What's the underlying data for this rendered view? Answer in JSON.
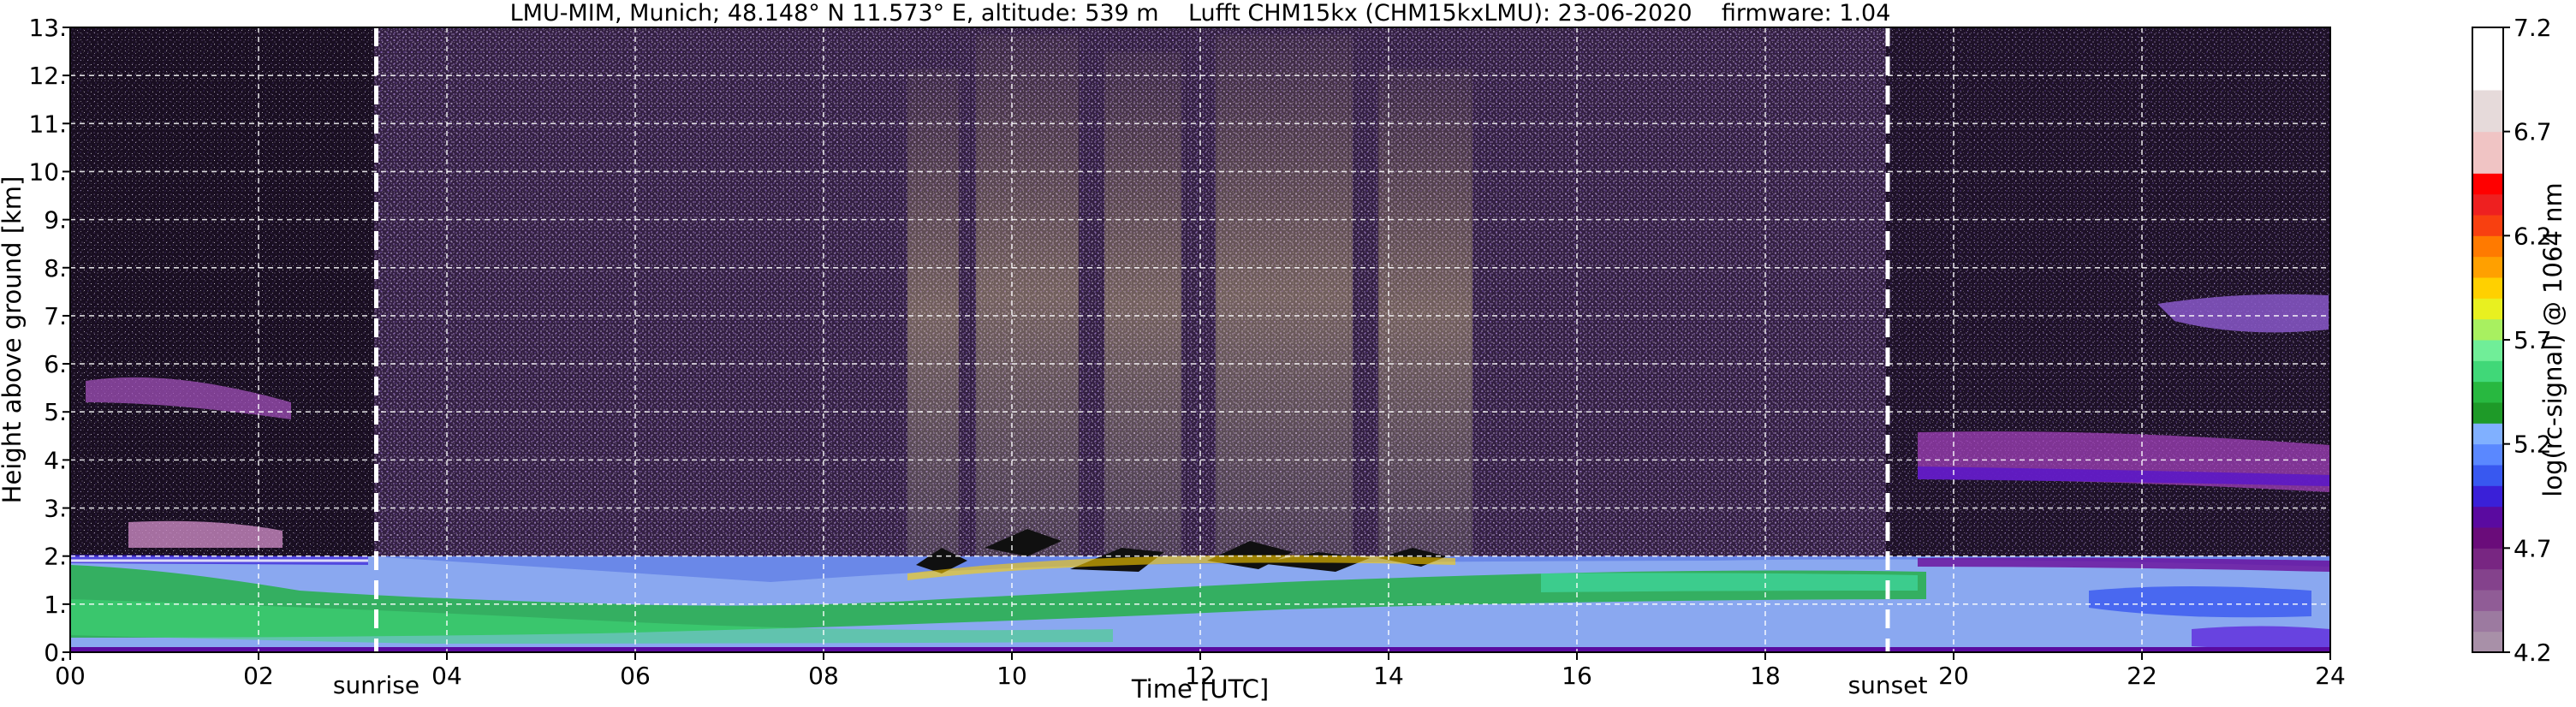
{
  "chart_data": {
    "type": "heatmap",
    "title": "LMU-MIM, Munich; 48.148° N 11.573° E, altitude: 539 m    Lufft CHM15kx (CHM15kxLMU): 23-06-2020    firmware: 1.04",
    "xlabel": "Time [UTC]",
    "ylabel": "Height above ground [km]",
    "xlim": [
      0,
      24
    ],
    "ylim": [
      0,
      13
    ],
    "x_ticks": [
      0,
      2,
      4,
      6,
      8,
      10,
      12,
      14,
      16,
      18,
      20,
      22,
      24
    ],
    "x_tick_labels": [
      "00",
      "02",
      "04",
      "06",
      "08",
      "10",
      "12",
      "14",
      "16",
      "18",
      "20",
      "22",
      "24"
    ],
    "y_ticks": [
      0,
      1,
      2,
      3,
      4,
      5,
      6,
      7,
      8,
      9,
      10,
      11,
      12,
      13
    ],
    "y_tick_labels": [
      "0.",
      "1.",
      "2.",
      "3.",
      "4.",
      "5.",
      "6.",
      "7.",
      "8.",
      "9.",
      "10.",
      "11.",
      "12.",
      "13."
    ],
    "grid": true,
    "events": [
      {
        "label": "sunrise",
        "x": 3.25
      },
      {
        "label": "sunset",
        "x": 19.3
      }
    ],
    "colorbar": {
      "label": "log(rc-signal) @ 1064 nm",
      "min": 4.2,
      "max": 7.2,
      "tick_labels": [
        "4.2",
        "4.7",
        "5.2",
        "5.7",
        "6.2",
        "6.7",
        "7.2"
      ],
      "tick_values": [
        4.2,
        4.7,
        5.2,
        5.7,
        6.2,
        6.7,
        7.2
      ],
      "bands": [
        {
          "from": 4.2,
          "to": 4.3,
          "color": "#a890a8"
        },
        {
          "from": 4.3,
          "to": 4.4,
          "color": "#9c7aa0"
        },
        {
          "from": 4.4,
          "to": 4.5,
          "color": "#905c96"
        },
        {
          "from": 4.5,
          "to": 4.6,
          "color": "#84428c"
        },
        {
          "from": 4.6,
          "to": 4.7,
          "color": "#782682"
        },
        {
          "from": 4.7,
          "to": 4.8,
          "color": "#6a0c7a"
        },
        {
          "from": 4.8,
          "to": 4.9,
          "color": "#5a0aa0"
        },
        {
          "from": 4.9,
          "to": 5.0,
          "color": "#3a20d8"
        },
        {
          "from": 5.0,
          "to": 5.1,
          "color": "#3858f0"
        },
        {
          "from": 5.1,
          "to": 5.2,
          "color": "#5a88ff"
        },
        {
          "from": 5.2,
          "to": 5.3,
          "color": "#80b0ff"
        },
        {
          "from": 5.3,
          "to": 5.4,
          "color": "#1e9a28"
        },
        {
          "from": 5.4,
          "to": 5.5,
          "color": "#28b840"
        },
        {
          "from": 5.5,
          "to": 5.6,
          "color": "#40d878"
        },
        {
          "from": 5.6,
          "to": 5.7,
          "color": "#70ee98"
        },
        {
          "from": 5.7,
          "to": 5.8,
          "color": "#a8f060"
        },
        {
          "from": 5.8,
          "to": 5.9,
          "color": "#e8f020"
        },
        {
          "from": 5.9,
          "to": 6.0,
          "color": "#ffd000"
        },
        {
          "from": 6.0,
          "to": 6.1,
          "color": "#ffa000"
        },
        {
          "from": 6.1,
          "to": 6.2,
          "color": "#ff7a00"
        },
        {
          "from": 6.2,
          "to": 6.3,
          "color": "#f84010"
        },
        {
          "from": 6.3,
          "to": 6.4,
          "color": "#ee2020"
        },
        {
          "from": 6.4,
          "to": 6.5,
          "color": "#ff0000"
        },
        {
          "from": 6.5,
          "to": 6.7,
          "color": "#f0c4c4"
        },
        {
          "from": 6.7,
          "to": 6.9,
          "color": "#e6dada"
        },
        {
          "from": 6.9,
          "to": 7.2,
          "color": "#ffffff"
        }
      ]
    }
  }
}
